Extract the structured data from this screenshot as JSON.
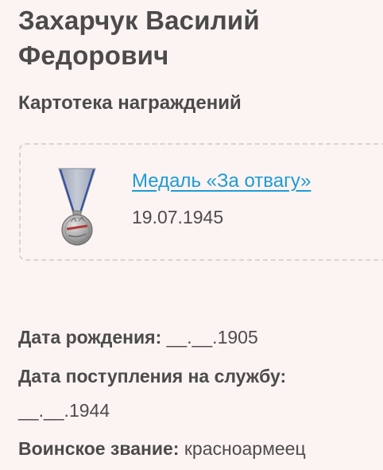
{
  "person": {
    "name": "Захарчук Василий Федорович"
  },
  "awards_section": {
    "title": "Картотека награждений",
    "items": [
      {
        "title": "Медаль «За отвагу»",
        "date": "19.07.1945",
        "icon": "medal-za-otvagu-icon"
      }
    ]
  },
  "details": {
    "birth_date": {
      "label": "Дата рождения:",
      "value": "__.__.1905"
    },
    "service_entry": {
      "label": "Дата поступления на службу:",
      "value": "__.__.1944"
    },
    "rank": {
      "label": "Воинское звание:",
      "value": "красноармеец"
    }
  },
  "colors": {
    "background": "#fcf4f2",
    "link": "#1e9bd7",
    "text": "#4b4b4b",
    "card_border": "#d9d4d2"
  }
}
